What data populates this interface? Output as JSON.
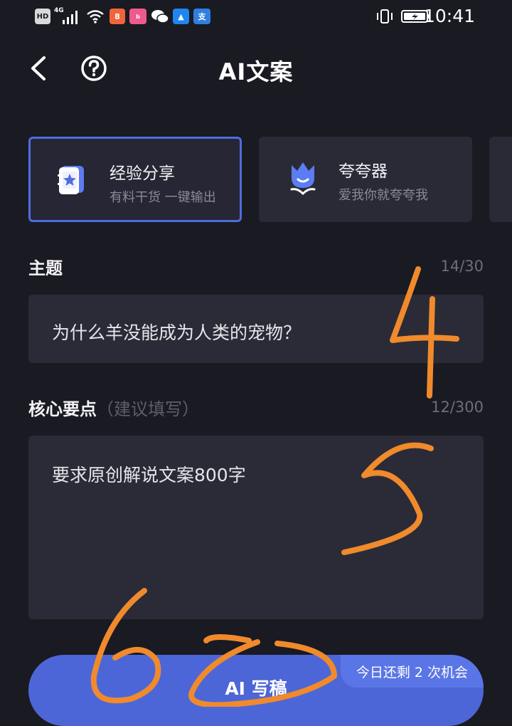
{
  "status_bar": {
    "time": "10:41",
    "hd": "HD",
    "network": "4G",
    "colors": {
      "app1": "#f0643c",
      "app2": "#ee5a8c",
      "app3": "#1f86f0",
      "app4": "#2f7fe0"
    },
    "icons": [
      "hd-icon",
      "signal-icon",
      "wifi-icon",
      "app-icon",
      "bilibili-icon",
      "wechat-icon",
      "app-icon",
      "alipay-icon",
      "vibrate-icon",
      "battery-icon"
    ]
  },
  "header": {
    "title": "AI文案",
    "back_icon": "chevron-left-icon",
    "help_icon": "help-circle-icon"
  },
  "cards": [
    {
      "title": "经验分享",
      "subtitle": "有料干货 一键输出",
      "icon": "notebook-star-icon",
      "selected": true
    },
    {
      "title": "夸夸器",
      "subtitle": "爱我你就夸夸我",
      "icon": "flower-icon",
      "selected": false
    }
  ],
  "topic": {
    "label": "主题",
    "counter": "14/30",
    "value": "为什么羊没能成为人类的宠物？"
  },
  "key_points": {
    "label": "核心要点",
    "hint": "（建议填写）",
    "counter": "12/300",
    "value": "要求原创解说文案800字"
  },
  "write_button": {
    "label": "AI 写稿",
    "remaining": "今日还剩 2 次机会"
  },
  "annotations": {
    "labels": [
      "4",
      "5",
      "6",
      "6"
    ],
    "color": "#f08a2c"
  },
  "colors": {
    "background": "#1a1a23",
    "accent": "#4c66d8",
    "card": "#2a2a36"
  }
}
